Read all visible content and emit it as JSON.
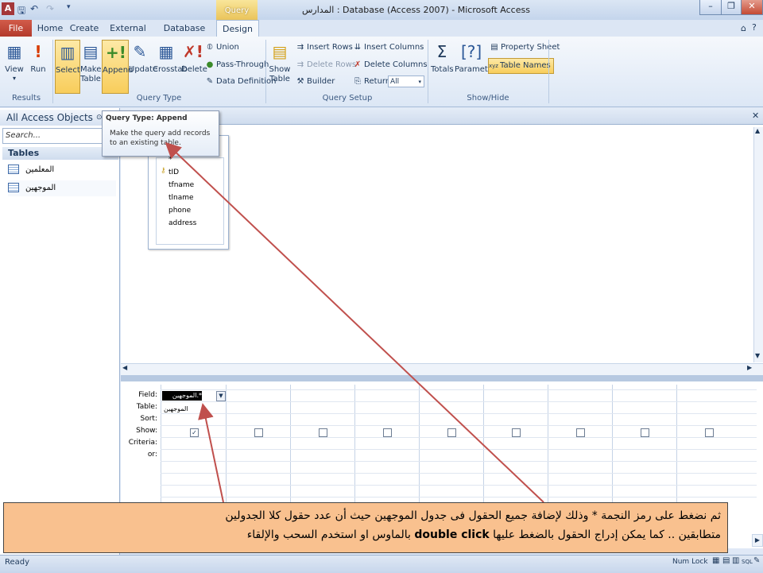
{
  "window": {
    "title": "المدارس : Database (Access 2007) - Microsoft Access",
    "context_tab_title": "Query Tools",
    "app_icon_letter": "A",
    "controls": {
      "minimize": "–",
      "restore": "❐",
      "close": "✕"
    }
  },
  "tabs": {
    "file": "File",
    "home": "Home",
    "create": "Create",
    "external": "External Data",
    "dbtools": "Database Tools",
    "design": "Design"
  },
  "ribbon": {
    "results": {
      "label": "Results",
      "view": "View",
      "run": "Run"
    },
    "query_type": {
      "label": "Query Type",
      "select": "Select",
      "make_table": "Make\nTable",
      "append": "Append",
      "update": "Update",
      "crosstab": "Crosstab",
      "delete": "Delete",
      "union": "Union",
      "pass_through": "Pass-Through",
      "data_definition": "Data Definition"
    },
    "query_setup": {
      "label": "Query Setup",
      "show_table": "Show\nTable",
      "insert_rows": "Insert Rows",
      "delete_rows": "Delete Rows",
      "builder": "Builder",
      "insert_columns": "Insert Columns",
      "delete_columns": "Delete Columns",
      "return_label": "Return:",
      "return_value": "All"
    },
    "show_hide": {
      "label": "Show/Hide",
      "totals": "Totals",
      "parameters": "Parameters",
      "property_sheet": "Property Sheet",
      "table_names": "Table Names"
    }
  },
  "nav": {
    "header": "All Access Objects",
    "search_placeholder": "Search...",
    "group": "Tables",
    "items": [
      "المعلمين",
      "الموجهين"
    ]
  },
  "tooltip": {
    "title": "Query Type: Append",
    "body": "Make the query add records to an existing table."
  },
  "table_box": {
    "fields": [
      "*",
      "tID",
      "tfname",
      "tlname",
      "phone",
      "address"
    ]
  },
  "grid": {
    "row_labels": [
      "Field:",
      "Table:",
      "Sort:",
      "Show:",
      "Criteria:",
      "or:"
    ],
    "field_value": "الموجهين.*",
    "table_value": "الموجهين",
    "show_checked": [
      true,
      false,
      false,
      false,
      false,
      false,
      false,
      false,
      false
    ]
  },
  "caption": {
    "line1": "ثم نضغط على رمز النجمة * وذلك لإضافة جميع الحقول فى جدول الموجهين  حيث أن عدد حقول كلا الجدولين",
    "line2a": "متطابقين .. كما يمكن إدراج الحقول بالضغط عليها ",
    "line2b": "double click",
    "line2c": " بالماوس او استخدم السحب والإلقاء"
  },
  "status": {
    "ready": "Ready",
    "numlock": "Num Lock"
  },
  "colors": {
    "caption_bg": "#f9c18f",
    "arrow": "#c0504d",
    "file_tab": "#b33a2c",
    "active_button": "#f8cd5b"
  }
}
